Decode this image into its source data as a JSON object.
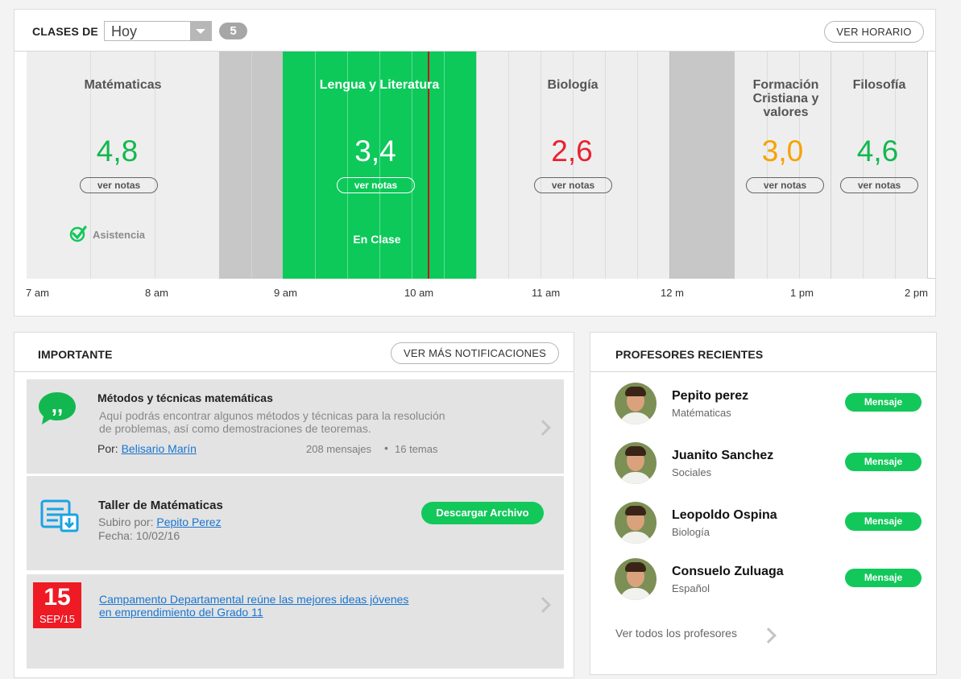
{
  "schedule": {
    "title": "CLASES DE",
    "day_selected": "Hoy",
    "class_count": "5",
    "schedule_button": "VER HORARIO",
    "classes": [
      {
        "name": "Matématicas",
        "grade": "4,8",
        "grade_color": "#12b84f",
        "notes_label": "ver notas",
        "status": "Asistencia"
      },
      {
        "name": "Lengua y Literatura",
        "grade": "3,4",
        "grade_color": "#ffffff",
        "notes_label": "ver notas",
        "status": "En Clase"
      },
      {
        "name": "Biología",
        "grade": "2,6",
        "grade_color": "#e8222e",
        "notes_label": "ver notas"
      },
      {
        "name": "Formación Cristiana y valores",
        "grade": "3,0",
        "grade_color": "#f5a300",
        "notes_label": "ver notas"
      },
      {
        "name": "Filosofía",
        "grade": "4,6",
        "grade_color": "#12b84f",
        "notes_label": "ver notas"
      }
    ],
    "time_ticks": [
      "7 am",
      "8 am",
      "9 am",
      "10 am",
      "11 am",
      "12 m",
      "1 pm",
      "2 pm"
    ]
  },
  "important": {
    "title": "IMPORTANTE",
    "more_button": "VER MÁS NOTIFICACIONES",
    "forum": {
      "icon": "chat-bubble-icon",
      "title": "Métodos y técnicas matemáticas",
      "description": "Aquí podrás encontrar algunos métodos y técnicas para la resolución de problemas, así como demostraciones de teoremas.",
      "by_label": "Por:",
      "author": "Belisario Marín",
      "messages": "208 mensajes",
      "topics": "16 temas"
    },
    "file": {
      "icon": "document-download-icon",
      "title": "Taller de Matématicas",
      "uploaded_label": "Subiro por:",
      "uploader": "Pepito Perez",
      "date": "Fecha: 10/02/16",
      "download_button": "Descargar Archivo"
    },
    "event": {
      "day": "15",
      "month": "SEP/15",
      "title": "Campamento Departamental reúne las mejores ideas jóvenes en emprendimiento del Grado 11"
    }
  },
  "teachers": {
    "title": "PROFESORES RECIENTES",
    "message_label": "Mensaje",
    "list": [
      {
        "name": "Pepito perez",
        "subject": "Matématicas"
      },
      {
        "name": "Juanito Sanchez",
        "subject": "Sociales"
      },
      {
        "name": "Leopoldo Ospina",
        "subject": "Biología"
      },
      {
        "name": "Consuelo Zuluaga",
        "subject": "Español"
      }
    ],
    "see_all": "Ver todos los profesores"
  },
  "colors": {
    "accent_green": "#12c85a",
    "active_class": "#0dc95a",
    "break_gray": "#c7c7c7",
    "now_line": "#c0171b",
    "link_blue": "#1a75cf",
    "date_red": "#ee1a24"
  }
}
